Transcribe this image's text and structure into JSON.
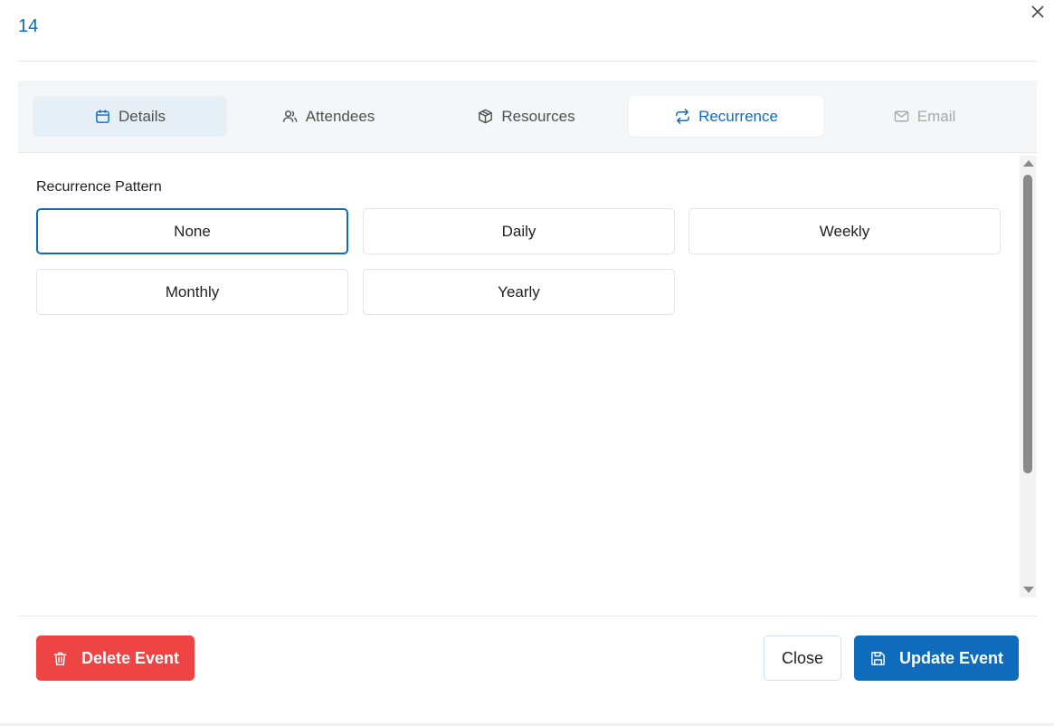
{
  "dialog": {
    "title": "14"
  },
  "tabs": [
    {
      "label": "Details",
      "icon": "calendar-icon",
      "state": "visited"
    },
    {
      "label": "Attendees",
      "icon": "people-icon",
      "state": "normal"
    },
    {
      "label": "Resources",
      "icon": "box-icon",
      "state": "normal"
    },
    {
      "label": "Recurrence",
      "icon": "repeat-icon",
      "state": "active"
    },
    {
      "label": "Email",
      "icon": "mail-icon",
      "state": "disabled"
    }
  ],
  "recurrence": {
    "label": "Recurrence Pattern",
    "options": [
      "None",
      "Daily",
      "Weekly",
      "Monthly",
      "Yearly"
    ],
    "selected": "None"
  },
  "footer": {
    "delete_label": "Delete Event",
    "close_label": "Close",
    "update_label": "Update Event"
  },
  "colors": {
    "accent": "#0f6cbd",
    "danger": "#ef4444",
    "tab_bar": "#f5f6f8"
  }
}
